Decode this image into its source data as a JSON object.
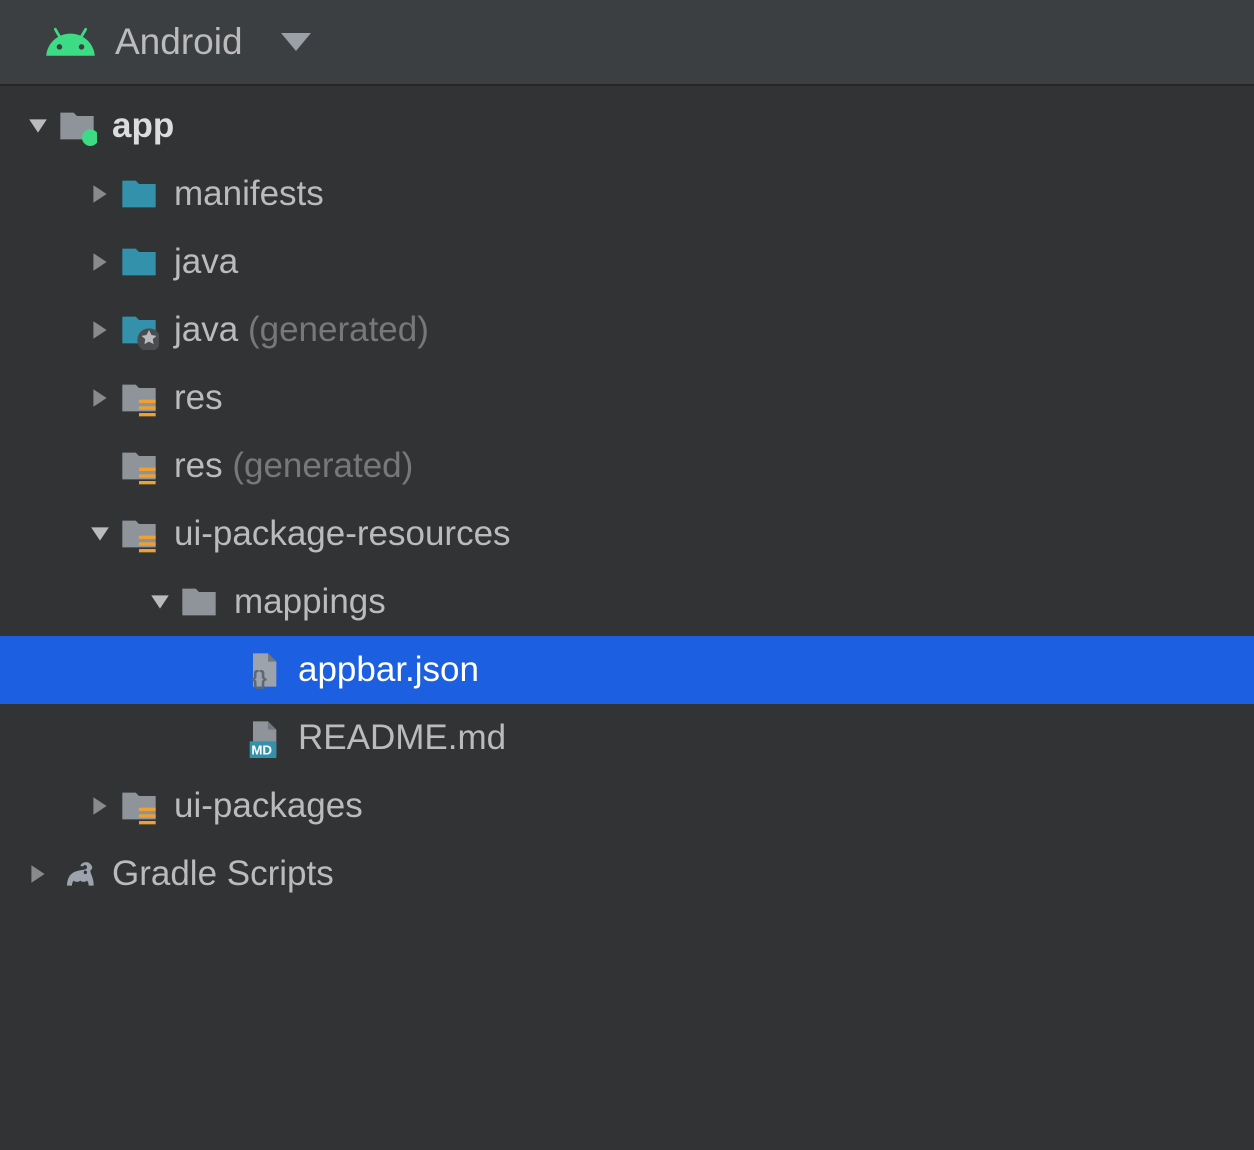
{
  "header": {
    "title": "Android"
  },
  "tree": {
    "items": [
      {
        "label": "app",
        "bold": true
      },
      {
        "label": "manifests"
      },
      {
        "label": "java"
      },
      {
        "label": "java",
        "suffix": " (generated)"
      },
      {
        "label": "res"
      },
      {
        "label": "res",
        "suffix": " (generated)"
      },
      {
        "label": "ui-package-resources"
      },
      {
        "label": "mappings"
      },
      {
        "label": "appbar.json"
      },
      {
        "label": "README.md"
      },
      {
        "label": "ui-packages"
      },
      {
        "label": "Gradle Scripts"
      }
    ]
  }
}
